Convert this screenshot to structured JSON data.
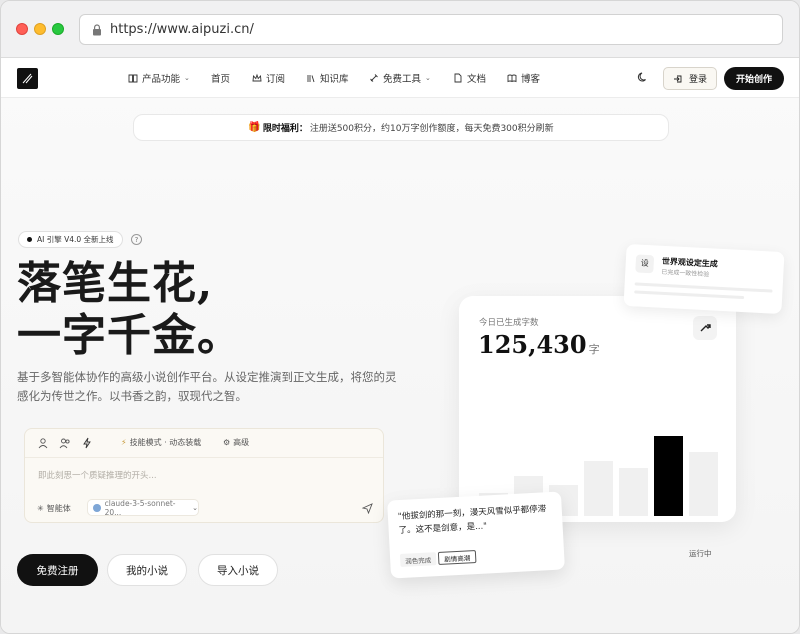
{
  "browser": {
    "url": "https://www.aipuzi.cn/"
  },
  "nav": {
    "items": [
      {
        "label": "产品功能",
        "dropdown": true
      },
      {
        "label": "首页",
        "dropdown": false
      },
      {
        "label": "订阅",
        "dropdown": false
      },
      {
        "label": "知识库",
        "dropdown": false
      },
      {
        "label": "免费工具",
        "dropdown": true
      },
      {
        "label": "文档",
        "dropdown": false
      },
      {
        "label": "博客",
        "dropdown": false
      }
    ],
    "login": "登录",
    "start": "开始创作"
  },
  "promo": {
    "title": "限时福利：",
    "text": "注册送500积分，约10万字创作额度，每天免费300积分刷新"
  },
  "hero": {
    "badge": "AI 引擎 V4.0 全新上线",
    "help_icon": "?",
    "headline_line1": "落笔生花,",
    "headline_line2": "一字千金。",
    "description": "基于多智能体协作的高级小说创作平台。从设定推演到正文生成，将您的灵感化为传世之作。以书香之韵，驭现代之智。"
  },
  "input_card": {
    "mode": "技能模式 · 动态装载",
    "advanced": "高级",
    "placeholder": "即此刻思一个质疑推理的开头...",
    "agent": "智能体",
    "model": "claude-3-5-sonnet-20..."
  },
  "cta": {
    "register": "免费注册",
    "my_novels": "我的小说",
    "import": "导入小说"
  },
  "stats": {
    "label": "今日已生成字数",
    "value": "125,430",
    "unit": "字",
    "running": "运行中",
    "bars": [
      0.18,
      0.32,
      0.25,
      0.44,
      0.38,
      0.64,
      0.51
    ],
    "active_index": 5
  },
  "world_card": {
    "icon": "设",
    "title": "世界观设定生成",
    "subtitle": "已完成一致性检验"
  },
  "quote_card": {
    "text": "\"他拔剑的那一刻，漫天风雪似乎都停滞了。这不是剑意，是...\"",
    "tag1": "润色完成",
    "tag2": "剧情高潮"
  },
  "colors": {
    "accent": "#111111",
    "cream": "#fbf9f4",
    "promo_gift": "#d9534f"
  }
}
